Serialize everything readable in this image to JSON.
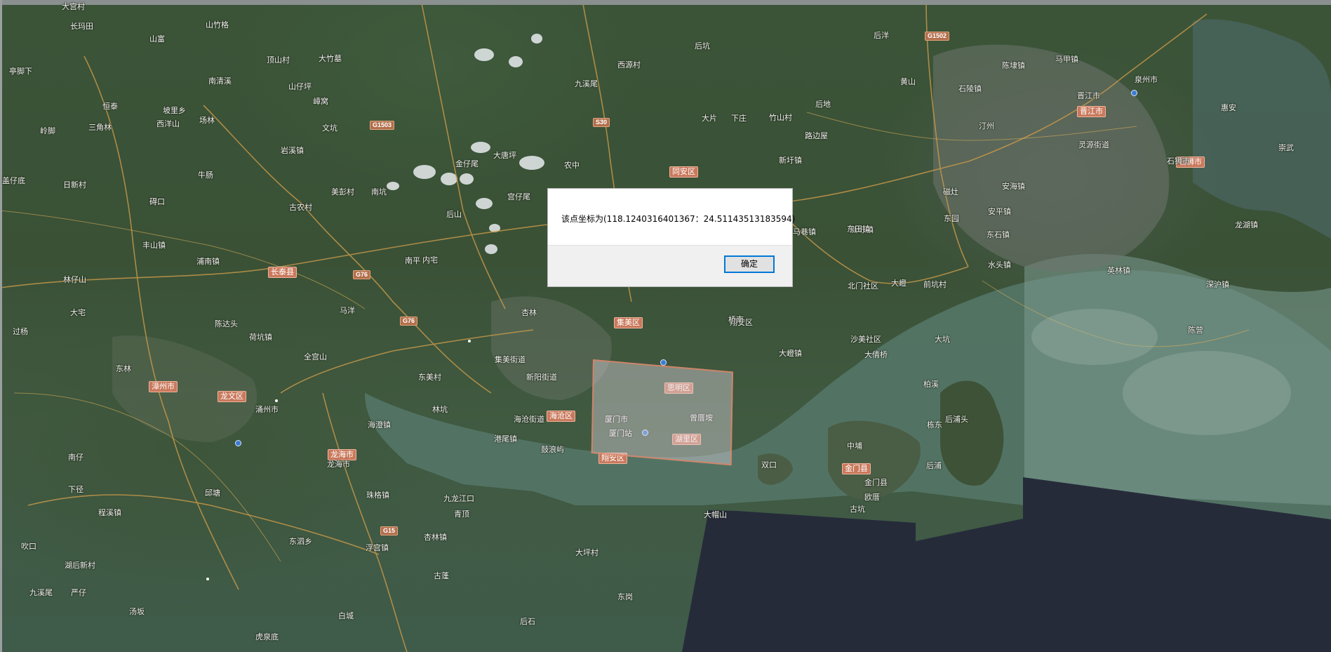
{
  "dialog": {
    "message": "该点坐标为(118.1240316401367：24.51143513183594)",
    "ok_label": "确定"
  },
  "map": {
    "places": [
      "大宫村",
      "长玛田",
      "山竹格",
      "山富",
      "大竹墓",
      "顶山村",
      "亭脚下",
      "南清溪",
      "山仔坪",
      "嶂窝",
      "恒泰",
      "坡里乡",
      "西洋山",
      "场林",
      "三角林",
      "岭脚",
      "日新村",
      "盖仔底",
      "牛肠",
      "碍口",
      "美彭村",
      "南坑",
      "古农村",
      "岩溪镇",
      "丰山镇",
      "浦南镇",
      "后山",
      "林仔山",
      "大宅",
      "过杨",
      "陈达头",
      "东林",
      "荷坑镇",
      "全宫山",
      "马洋",
      "南平",
      "林坑",
      "涌州市",
      "龙海市",
      "南仔",
      "下径",
      "程溪镇",
      "东泗乡",
      "邱塘",
      "吹口",
      "湖后新村",
      "九溪尾",
      "严仔",
      "汤坂",
      "虎泉底",
      "白城",
      "古蓬",
      "后石",
      "青顶",
      "东美村",
      "珠格镇",
      "杏林镇",
      "新阳街道",
      "集美街道",
      "海沧街道",
      "厦门市",
      "厦门站",
      "鼓浪屿",
      "曾厝垵",
      "翔安区",
      "大嶝镇",
      "金门县",
      "大帽山",
      "双口",
      "后浦",
      "中埔",
      "欧厝",
      "古坑",
      "后浦头",
      "浮宫镇",
      "九龙江口",
      "东岗",
      "大坪村",
      "栋东",
      "柏溪",
      "磁灶",
      "安海镇",
      "石狮市",
      "晋江市",
      "泉州市",
      "汀州",
      "灵源街道",
      "惠安",
      "崇武",
      "东石镇",
      "英林镇",
      "深沪镇",
      "龙湖镇",
      "陈埭镇",
      "陈营",
      "桥南",
      "杏林",
      "马巷镇",
      "新圩镇",
      "大嶝",
      "文坑",
      "金仔尾",
      "大唐坪",
      "农中",
      "宫仔尾",
      "西源村",
      "九溪尾",
      "后坑",
      "大片",
      "下庄",
      "竹山村",
      "路边屋",
      "新圩镇",
      "后洋",
      "内宅",
      "东园",
      "后地",
      "黄山",
      "石陵镇",
      "马甲镇",
      "水头镇",
      "安平镇",
      "东田镇",
      "前坑村",
      "大坑",
      "大倩桥",
      "沙美社区",
      "北门社区",
      "海澄镇",
      "港尾镇"
    ],
    "districts": [
      "长泰县",
      "漳州市",
      "龙文区",
      "龙海市",
      "海沧区",
      "思明区",
      "集美区",
      "同安区",
      "翔安区",
      "湖里区",
      "晋江市",
      "石狮市",
      "金门县"
    ],
    "roads": [
      "G1503",
      "G76",
      "G76",
      "S30",
      "G15",
      "G1502"
    ]
  }
}
